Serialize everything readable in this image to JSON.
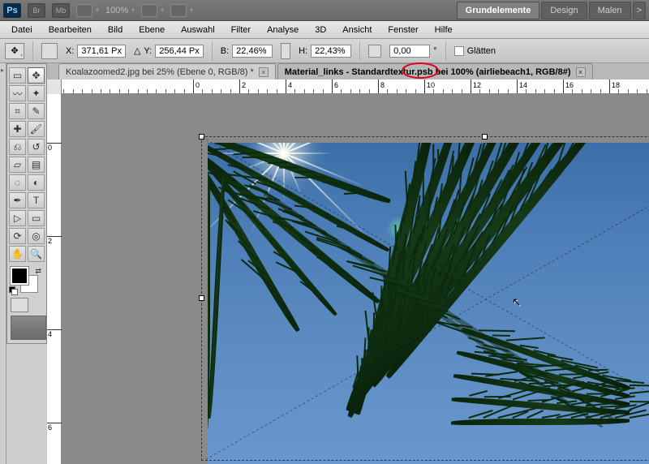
{
  "top": {
    "logo": "Ps",
    "br": "Br",
    "mb": "Mb",
    "zoom": "100%",
    "workspaces": {
      "grund": "Grundelemente",
      "design": "Design",
      "malen": "Malen",
      "arrow": ">"
    }
  },
  "menu": {
    "datei": "Datei",
    "bearbeiten": "Bearbeiten",
    "bild": "Bild",
    "ebene": "Ebene",
    "auswahl": "Auswahl",
    "filter": "Filter",
    "analyse": "Analyse",
    "dd": "3D",
    "ansicht": "Ansicht",
    "fenster": "Fenster",
    "hilfe": "Hilfe"
  },
  "options": {
    "x_label": "X:",
    "x_val": "371,61 Px",
    "y_label": "Y:",
    "y_val": "256,44 Px",
    "w_label": "B:",
    "w_val": "22,46%",
    "h_label": "H:",
    "h_val": "22,43%",
    "angle_val": "0,00",
    "angle_deg": "°",
    "glatten": "Glätten",
    "delta": "△"
  },
  "tabs": {
    "t1": "Koalazoomed2.jpg bei 25% (Ebene 0, RGB/8) *",
    "t2": "Material_links - Standardtextur.psb bei 100% (airliebeach1, RGB/8#)",
    "close": "×"
  },
  "ruler": {
    "h": [
      "0",
      "2",
      "4",
      "6",
      "8",
      "10",
      "12",
      "14",
      "16",
      "18"
    ],
    "v": [
      "0",
      "2",
      "4",
      "6"
    ]
  },
  "icons": {
    "move": "✥",
    "marquee": "▭",
    "lasso": "〰",
    "wand": "✦",
    "crop": "⌗",
    "eyedrop": "✎",
    "heal": "✚",
    "brush": "🖌",
    "stamp": "⎌",
    "history": "↺",
    "eraser": "▱",
    "grad": "▤",
    "blur": "◌",
    "dodge": "◐",
    "pen": "✒",
    "type": "T",
    "path": "▷",
    "shape": "▭",
    "hand": "✋",
    "zoomt": "🔍",
    "arrow": "▾",
    "tri": "▸",
    "cursor": "↖"
  }
}
